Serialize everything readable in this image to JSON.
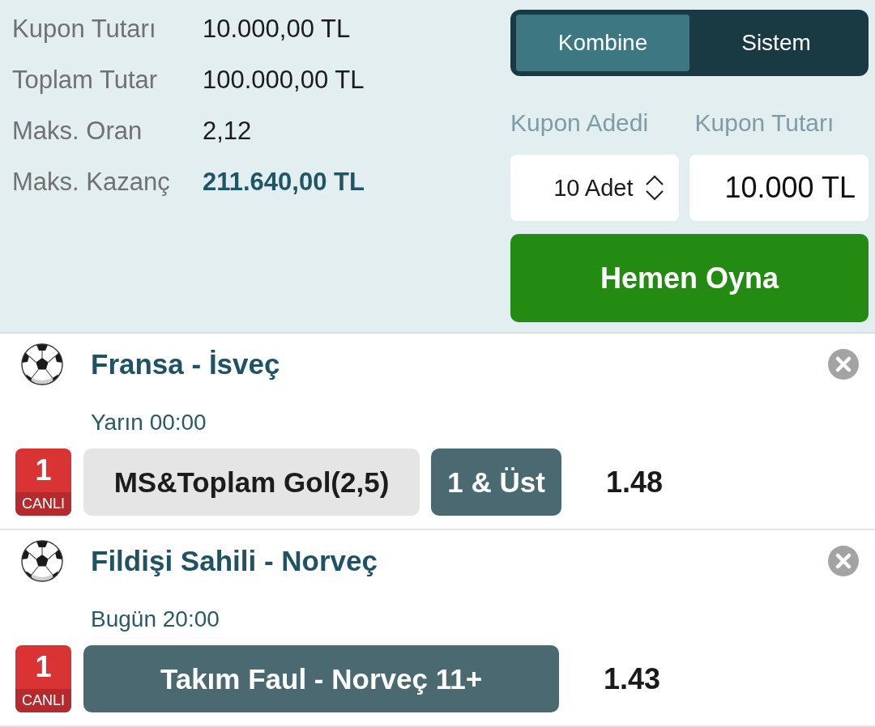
{
  "summary": [
    {
      "label": "Kupon Tutarı",
      "value": "10.000,00 TL",
      "highlighted": false
    },
    {
      "label": "Toplam Tutar",
      "value": "100.000,00 TL",
      "highlighted": false
    },
    {
      "label": "Maks. Oran",
      "value": "2,12",
      "highlighted": false
    },
    {
      "label": "Maks. Kazanç",
      "value": "211.640,00 TL",
      "highlighted": true
    }
  ],
  "bet_type_tabs": [
    {
      "label": "Kombine",
      "selected": true
    },
    {
      "label": "Sistem",
      "selected": false
    }
  ],
  "stake_form": {
    "count_label": "Kupon Adedi",
    "count_value": "10 Adet",
    "amount_label": "Kupon Tutarı",
    "amount_value": "10.000 TL",
    "submit": "Hemen Oyna"
  },
  "events": [
    {
      "match": "Fransa - İsveç",
      "time": "Yarın 00:00",
      "badge": {
        "number": "1",
        "label": "CANLI"
      },
      "bet": {
        "kind": "split",
        "market": "MS&Toplam Gol(2,5)",
        "pick": "1 & Üst"
      },
      "odds": "1.48"
    },
    {
      "match": "Fildişi Sahili - Norveç",
      "time": "Bugün 20:00",
      "badge": {
        "number": "1",
        "label": "CANLI"
      },
      "bet": {
        "kind": "combined",
        "pick": "Takım Faul - Norveç 11+"
      },
      "odds": "1.43"
    }
  ]
}
